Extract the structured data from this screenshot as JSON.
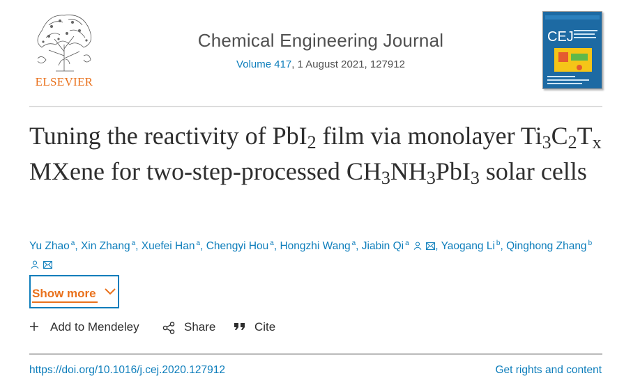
{
  "publisher": {
    "name": "ELSEVIER"
  },
  "journal": {
    "title": "Chemical Engineering Journal",
    "volume_link": "Volume 417",
    "issue_rest": ", 1 August 2021, 127912"
  },
  "cover": {
    "abbrev": "CEJ"
  },
  "article": {
    "title_parts": [
      "Tuning the reactivity of PbI",
      "2",
      " film via monolayer Ti",
      "3",
      "C",
      "2",
      "T",
      "x",
      " MXene for two-step-processed CH",
      "3",
      "NH",
      "3",
      "PbI",
      "3",
      " solar cells"
    ]
  },
  "authors": [
    {
      "name": "Yu Zhao",
      "aff": "a"
    },
    {
      "name": "Xin Zhang",
      "aff": "a"
    },
    {
      "name": "Xuefei Han",
      "aff": "a"
    },
    {
      "name": "Chengyi Hou",
      "aff": "a"
    },
    {
      "name": "Hongzhi Wang",
      "aff": "a"
    },
    {
      "name": "Jiabin Qi",
      "aff": "a"
    },
    {
      "name": "Yaogang Li",
      "aff": "b"
    },
    {
      "name": "Qinghong Zhang",
      "aff": "b"
    }
  ],
  "show_more": {
    "label": "Show more"
  },
  "actions": {
    "mendeley": "Add to Mendeley",
    "share": "Share",
    "cite": "Cite"
  },
  "footer": {
    "doi": "https://doi.org/10.1016/j.cej.2020.127912",
    "rights": "Get rights and content"
  },
  "colors": {
    "link": "#0c7dbb",
    "accent": "#e9711c",
    "text": "#2e2e2e"
  }
}
